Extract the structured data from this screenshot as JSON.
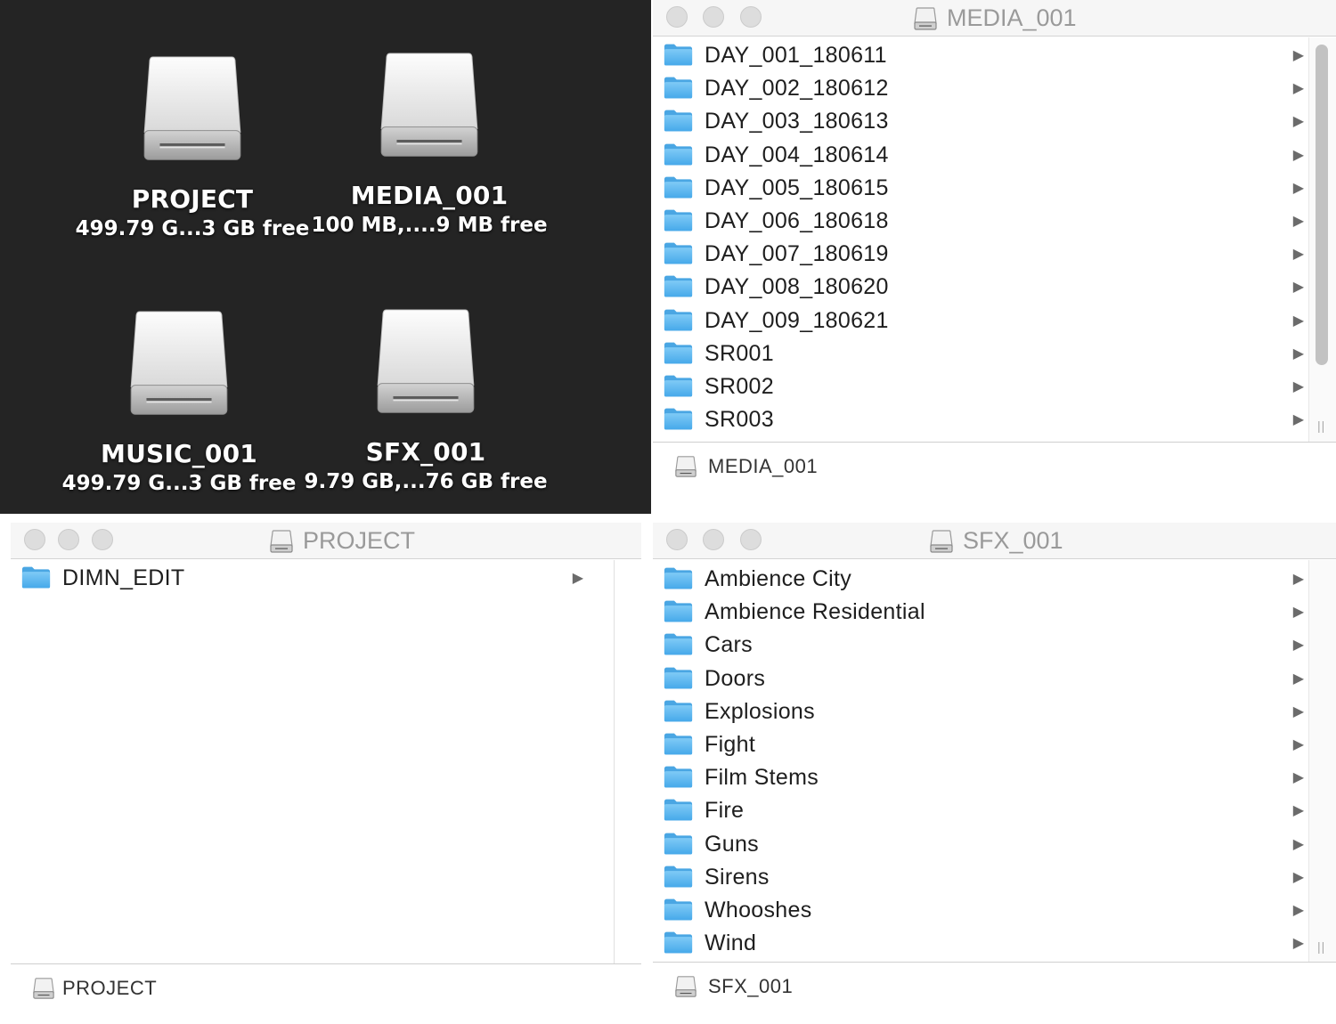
{
  "desktop": {
    "drives": [
      {
        "name": "PROJECT",
        "info": "499.79 G...3 GB free"
      },
      {
        "name": "MEDIA_001",
        "info": "100 MB,....9 MB free"
      },
      {
        "name": "MUSIC_001",
        "info": "499.79 G...3 GB free"
      },
      {
        "name": "SFX_001",
        "info": "9.79 GB,...76 GB free"
      }
    ]
  },
  "media_window": {
    "title": "MEDIA_001",
    "items": [
      "DAY_001_180611",
      "DAY_002_180612",
      "DAY_003_180613",
      "DAY_004_180614",
      "DAY_005_180615",
      "DAY_006_180618",
      "DAY_007_180619",
      "DAY_008_180620",
      "DAY_009_180621",
      "SR001",
      "SR002",
      "SR003"
    ],
    "path": "MEDIA_001"
  },
  "project_window": {
    "title": "PROJECT",
    "items": [
      "DIMN_EDIT"
    ],
    "path": "PROJECT"
  },
  "sfx_window": {
    "title": "SFX_001",
    "items": [
      "Ambience City",
      "Ambience Residential",
      "Cars",
      "Doors",
      "Explosions",
      "Fight",
      "Film Stems",
      "Fire",
      "Guns",
      "Sirens",
      "Whooshes",
      "Wind"
    ],
    "path": "SFX_001"
  },
  "icons": {
    "drive": "external-drive-icon",
    "folder": "folder-icon",
    "disclosure": "disclosure-arrow-icon"
  },
  "colors": {
    "desktop_bg": "#242424",
    "folder_blue": "#5cb8f0",
    "titlebar_bg": "#f6f6f6"
  }
}
